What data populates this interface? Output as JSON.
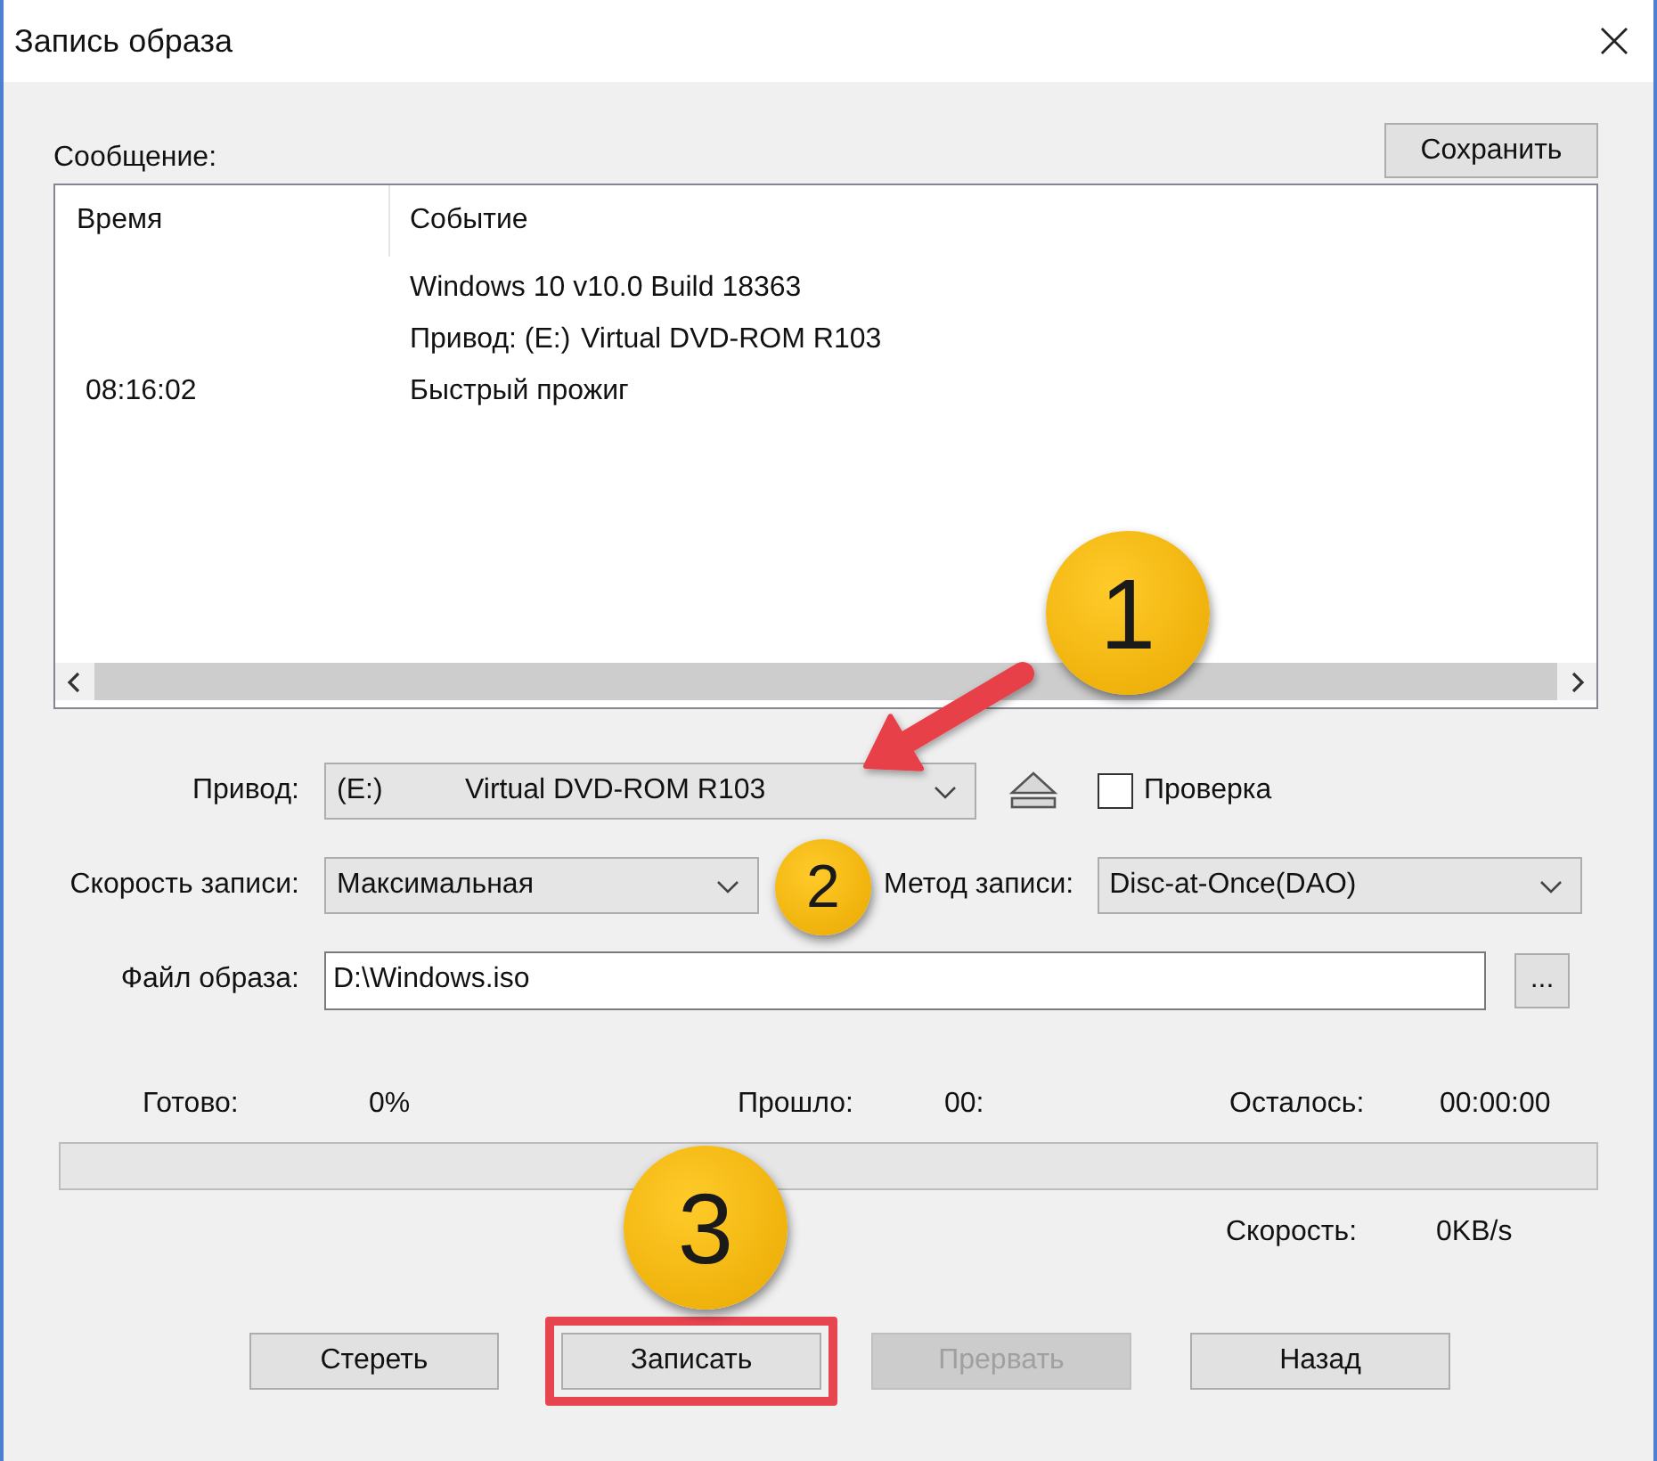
{
  "window": {
    "title": "Запись образа"
  },
  "log": {
    "label": "Сообщение:",
    "save_button": "Сохранить",
    "columns": [
      "Время",
      "Событие"
    ],
    "rows": [
      {
        "event": "Windows 10 v10.0 Build 18363"
      },
      {
        "event": "Привод: (E:)\tVirtual DVD-ROM R103"
      },
      {
        "time": "08:16:02",
        "event": "Быстрый прожиг"
      }
    ]
  },
  "drive": {
    "label": "Привод:",
    "letter": "(E:)",
    "name": "Virtual DVD-ROM R103"
  },
  "verify": {
    "label": "Проверка",
    "checked": false
  },
  "speed": {
    "label": "Скорость записи:",
    "value": "Максимальная"
  },
  "method": {
    "label": "Метод записи:",
    "value": "Disc-at-Once(DAO)"
  },
  "image_file": {
    "label": "Файл образа:",
    "value": "D:\\Windows.iso",
    "browse_button": "..."
  },
  "progress": {
    "done_label": "Готово:",
    "done_value": "0%",
    "elapsed_label": "Прошло:",
    "elapsed_value": "00:",
    "remaining_label": "Осталось:",
    "remaining_value": "00:00:00",
    "level": 0,
    "speed_label": "Скорость:",
    "speed_value": "0KB/s"
  },
  "buttons": [
    {
      "label": "Стереть",
      "disabled": false,
      "highlighted": false
    },
    {
      "label": "Записать",
      "disabled": false,
      "highlighted": true
    },
    {
      "label": "Прервать",
      "disabled": true,
      "highlighted": false
    },
    {
      "label": "Назад",
      "disabled": false,
      "highlighted": false
    }
  ],
  "annotations": [
    {
      "number": "1"
    },
    {
      "number": "2"
    },
    {
      "number": "3"
    }
  ]
}
